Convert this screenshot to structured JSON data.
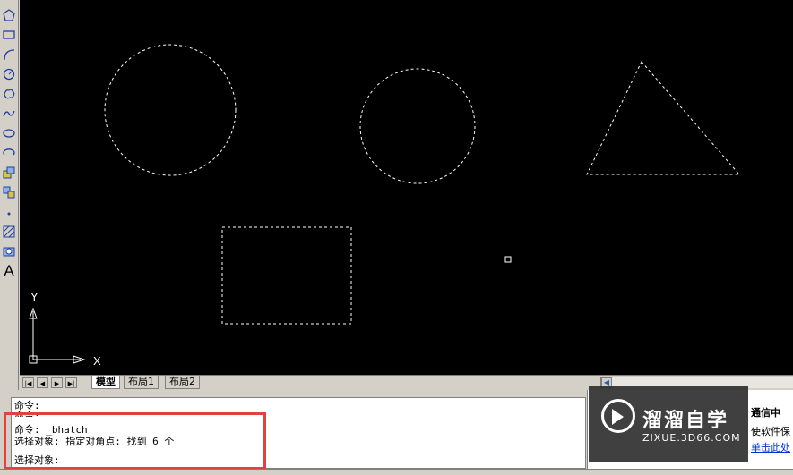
{
  "toolbar": {
    "icons": [
      "polygon-icon",
      "rectangle-icon",
      "arc-icon",
      "circle-icon",
      "revision-cloud-icon",
      "spline-icon",
      "ellipse-icon",
      "ellipse-arc-icon",
      "insert-block-icon",
      "make-block-icon",
      "point-icon",
      "hatch-icon",
      "region-icon",
      "multiline-text-icon"
    ],
    "text_label": "A"
  },
  "ucs": {
    "x_label": "X",
    "y_label": "Y"
  },
  "tabs": {
    "model": "模型",
    "layout1": "布局1",
    "layout2": "布局2"
  },
  "command": {
    "lines": [
      "命令:",
      "命令:",
      "命令: _bhatch",
      "选择对象: 指定对角点: 找到 6 个",
      "选择对象:"
    ]
  },
  "right_panel": {
    "line1": "通信中",
    "line2": "使软件保",
    "line3": "单击此处"
  },
  "watermark": {
    "title": "溜溜自学",
    "url": "ZIXUE.3D66.COM"
  },
  "colors": {
    "canvas": "#000000",
    "highlight": "#e2423e",
    "dashed": "#ffffff"
  }
}
